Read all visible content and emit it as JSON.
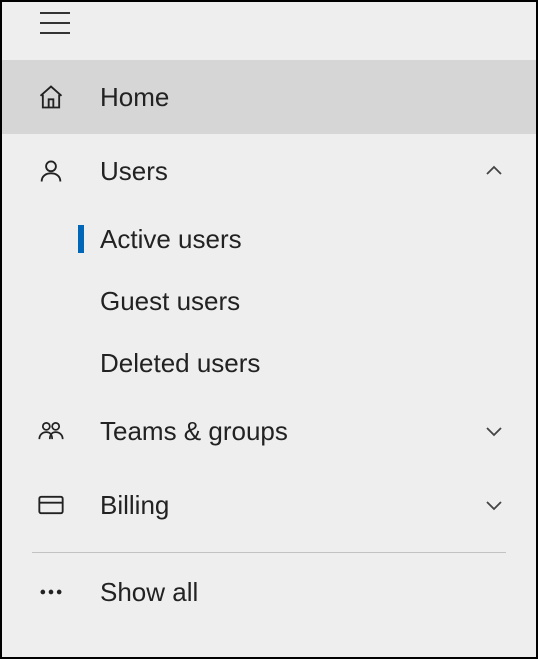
{
  "nav": {
    "home": {
      "label": "Home"
    },
    "users": {
      "label": "Users",
      "expanded": true,
      "children": {
        "active": {
          "label": "Active users",
          "selected": true
        },
        "guest": {
          "label": "Guest users"
        },
        "deleted": {
          "label": "Deleted users"
        }
      }
    },
    "teams": {
      "label": "Teams & groups",
      "expanded": false
    },
    "billing": {
      "label": "Billing",
      "expanded": false
    },
    "show_all": {
      "label": "Show all"
    }
  }
}
